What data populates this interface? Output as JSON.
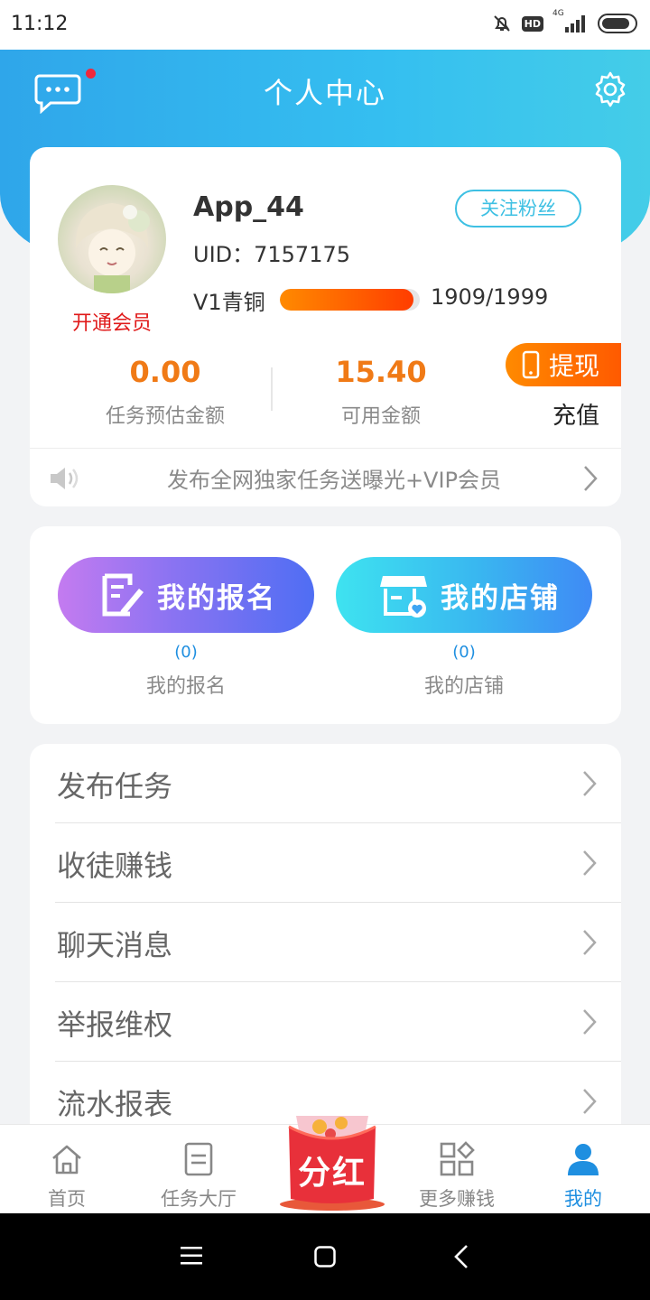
{
  "status_bar": {
    "time": "11:12",
    "network": "4G",
    "hd": "HD"
  },
  "header": {
    "title": "个人中心"
  },
  "profile": {
    "username": "App_44",
    "uid_label": "UID：",
    "uid": "7157175",
    "vip_link": "开通会员",
    "follow_button": "关注粉丝",
    "level": "V1青铜",
    "level_progress": 0.955,
    "level_count": "1909/1999"
  },
  "stats": {
    "estimated_amount": "0.00",
    "estimated_label": "任务预估金额",
    "available_amount": "15.40",
    "available_label": "可用金额",
    "withdraw_button": "提现",
    "recharge_button": "充值"
  },
  "notice": {
    "text": "发布全网独家任务送曝光+VIP会员"
  },
  "shortcuts": {
    "apply_button": "我的报名",
    "apply_count": "(0)",
    "apply_label": "我的报名",
    "shop_button": "我的店铺",
    "shop_count": "(0)",
    "shop_label": "我的店铺"
  },
  "menu": [
    {
      "label": "发布任务"
    },
    {
      "label": "收徒赚钱"
    },
    {
      "label": "聊天消息"
    },
    {
      "label": "举报维权"
    },
    {
      "label": "流水报表"
    }
  ],
  "tabbar": {
    "home": "首页",
    "tasks": "任务大厅",
    "dividend": "分红",
    "more": "更多赚钱",
    "mine": "我的",
    "active": "我的"
  },
  "colors": {
    "primary": "#35bff0",
    "orange": "#f07a16",
    "active_tab": "#1f8fe0",
    "vip_red": "#e01a1a"
  }
}
